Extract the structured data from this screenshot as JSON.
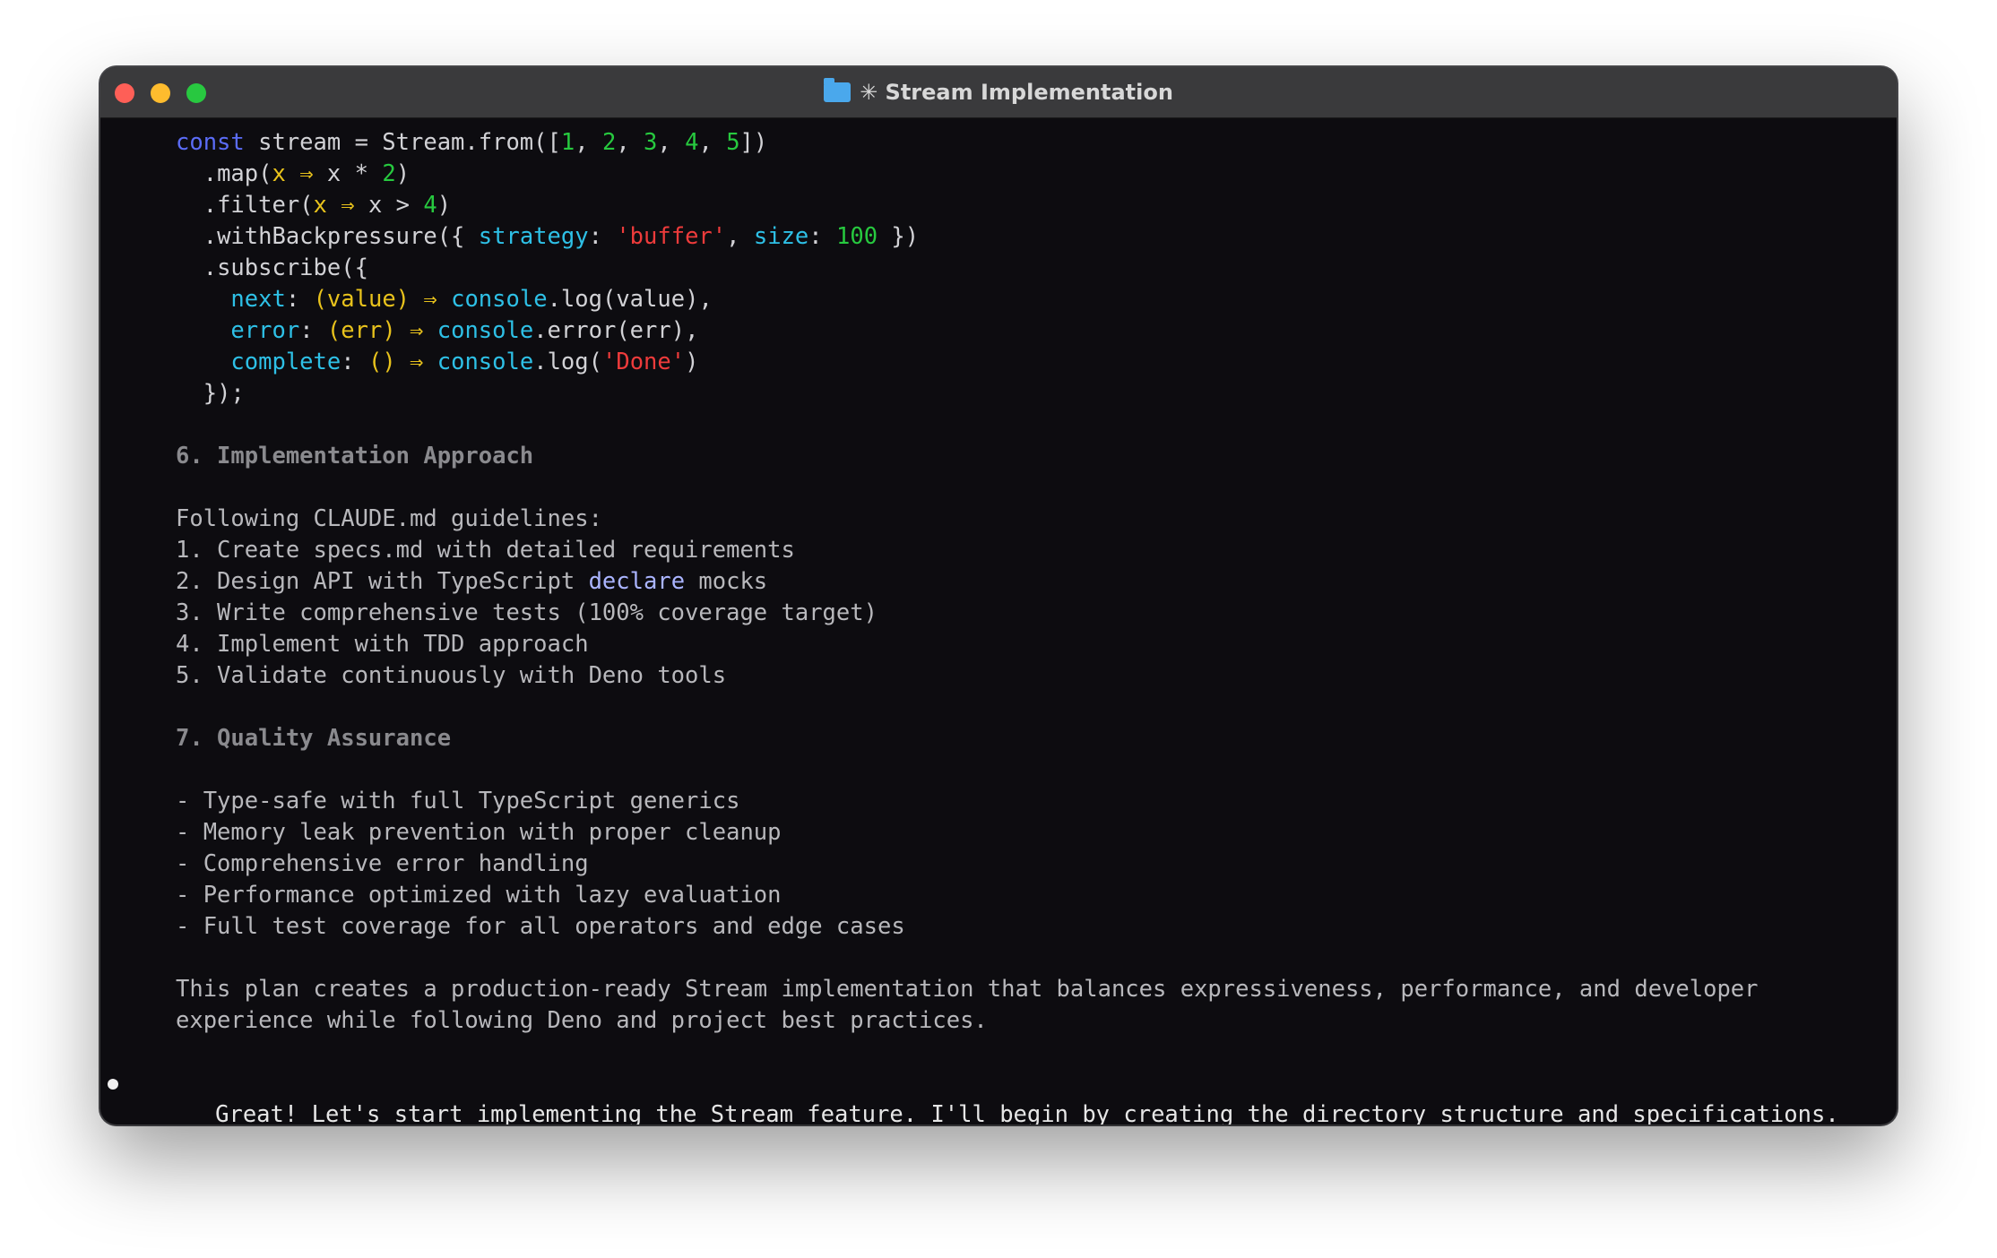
{
  "window": {
    "title": "✳ Stream Implementation",
    "folder_icon": "folder-icon",
    "traffic_lights": {
      "close": "#fe5f57",
      "minimize": "#febc2e",
      "zoom": "#28c840"
    }
  },
  "code": {
    "l1": {
      "kw": "const",
      "a": " stream = Stream.from([",
      "n1": "1",
      "c1": ", ",
      "n2": "2",
      "c2": ", ",
      "n3": "3",
      "c3": ", ",
      "n4": "4",
      "c4": ", ",
      "n5": "5",
      "end": "])"
    },
    "l2": {
      "a": ".map(",
      "p": "x",
      "arr": " ⇒ ",
      "b": "x * ",
      "n": "2",
      "end": ")"
    },
    "l3": {
      "a": ".filter(",
      "p": "x",
      "arr": " ⇒ ",
      "b": "x > ",
      "n": "4",
      "end": ")"
    },
    "l4": {
      "a": ".withBackpressure({ ",
      "k1": "strategy",
      "c1": ": ",
      "s": "'buffer'",
      "c2": ", ",
      "k2": "size",
      "c3": ": ",
      "n": "100",
      "end": " })"
    },
    "l5": {
      "a": ".subscribe({"
    },
    "l6": {
      "k": "next",
      "c": ": ",
      "p": "(value)",
      "arr": " ⇒ ",
      "obj": "console",
      "end": ".log(value),"
    },
    "l7": {
      "k": "error",
      "c": ": ",
      "p": "(err)",
      "arr": " ⇒ ",
      "obj": "console",
      "end": ".error(err),"
    },
    "l8": {
      "k": "complete",
      "c": ": ",
      "p": "()",
      "arr": " ⇒ ",
      "obj": "console",
      "mid": ".log(",
      "s": "'Done'",
      "end": ")"
    },
    "l9": {
      "a": "});"
    }
  },
  "section6": {
    "heading": "6. Implementation Approach",
    "intro": "Following CLAUDE.md guidelines:",
    "step1": "1. Create specs.md with detailed requirements",
    "step2_pre": "2. Design API with TypeScript ",
    "step2_kw": "declare",
    "step2_post": " mocks",
    "step3": "3. Write comprehensive tests (100% coverage target)",
    "step4": "4. Implement with TDD approach",
    "step5": "5. Validate continuously with Deno tools"
  },
  "section7": {
    "heading": "7. Quality Assurance",
    "items": [
      "- Type-safe with full TypeScript generics",
      "- Memory leak prevention with proper cleanup",
      "- Comprehensive error handling",
      "- Performance optimized with lazy evaluation",
      "- Full test coverage for all operators and edge cases"
    ]
  },
  "summary": {
    "line1": "This plan creates a production-ready Stream implementation that balances expressiveness, performance, and developer",
    "line2": "experience while following Deno and project best practices."
  },
  "assistant_message": "Great! Let's start implementing the Stream feature. I'll begin by creating the directory structure and specifications."
}
